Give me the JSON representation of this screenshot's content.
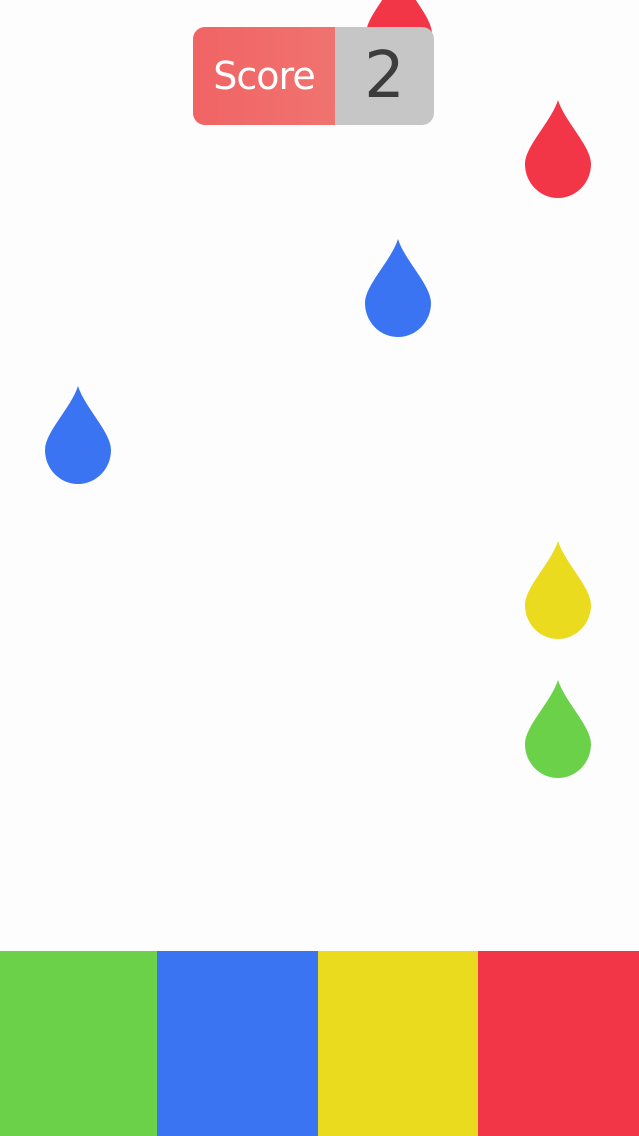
{
  "score": {
    "label": "Score",
    "value": "2",
    "label_color": "#f06b6b",
    "value_bg": "#c6c6c6"
  },
  "colors": {
    "red": "#f23648",
    "blue": "#3a74f2",
    "yellow": "#ebdb1f",
    "green": "#6bd148"
  },
  "drops": [
    {
      "name": "red-drop-top-partial",
      "color": "red"
    },
    {
      "name": "red-drop-right-upper",
      "color": "red"
    },
    {
      "name": "blue-drop-center",
      "color": "blue"
    },
    {
      "name": "blue-drop-left",
      "color": "blue"
    },
    {
      "name": "yellow-drop-right",
      "color": "yellow"
    },
    {
      "name": "green-drop-right",
      "color": "green"
    }
  ],
  "lanes": [
    {
      "name": "green-lane-button",
      "color": "green"
    },
    {
      "name": "blue-lane-button",
      "color": "blue"
    },
    {
      "name": "yellow-lane-button",
      "color": "yellow"
    },
    {
      "name": "red-lane-button",
      "color": "red"
    }
  ]
}
